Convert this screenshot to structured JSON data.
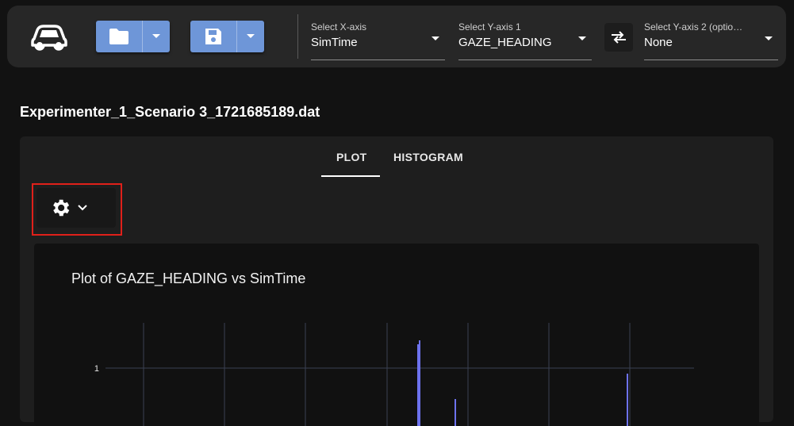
{
  "toolbar": {
    "logo_icon": "car-icon",
    "open_icon": "folder-icon",
    "save_icon": "floppy-disk-icon",
    "accent_color": "#6e96d8",
    "x_axis": {
      "label": "Select X-axis",
      "value": "SimTime"
    },
    "y_axis1": {
      "label": "Select Y-axis 1",
      "value": "GAZE_HEADING"
    },
    "swap_icon": "swap-arrows-icon",
    "y_axis2": {
      "label": "Select Y-axis 2 (optio…",
      "value": "None"
    }
  },
  "file": {
    "title": "Experimenter_1_Scenario 3_1721685189.dat"
  },
  "tabs": [
    {
      "label": "PLOT",
      "active": true
    },
    {
      "label": "HISTOGRAM",
      "active": false
    }
  ],
  "settings": {
    "icon": "gear-icon",
    "caret_icon": "chevron-down-icon",
    "highlight_color": "#e0201a"
  },
  "chart_data": {
    "type": "line",
    "title": "Plot of GAZE_HEADING vs SimTime",
    "xlabel": "",
    "ylabel": "",
    "y_tick_labels": [
      "1"
    ],
    "series_color": "#6d72ee",
    "grid": true
  }
}
